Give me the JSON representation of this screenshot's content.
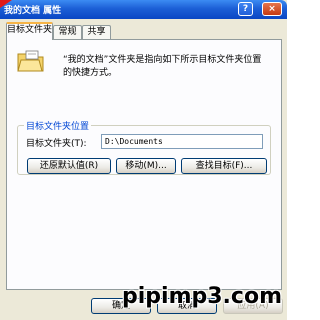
{
  "window": {
    "title": "我的文档 属性",
    "help_glyph": "?",
    "close_glyph": "×"
  },
  "tabs": [
    {
      "label": "目标文件夹",
      "active": true
    },
    {
      "label": "常规",
      "active": false
    },
    {
      "label": "共享",
      "active": false
    }
  ],
  "description": "“我的文档”文件夹是指向如下所示目标文件夹位置的快捷方式。",
  "group": {
    "legend": "目标文件夹位置",
    "field_label": "目标文件夹(T):",
    "field_value": "D:\\Documents"
  },
  "buttons": {
    "restore": "还原默认值(R)",
    "move": "移动(M)...",
    "find": "查找目标(F)..."
  },
  "footer": {
    "ok": "确定",
    "cancel": "取消",
    "apply": "应用(A)"
  },
  "watermark": "pipimp3.com",
  "colors": {
    "titlebar": "#0a46c4",
    "dialog_bg": "#ece9d8",
    "panel_bg": "#fcfcfe",
    "legend_text": "#0046d5",
    "tab_highlight": "#f7b446"
  }
}
